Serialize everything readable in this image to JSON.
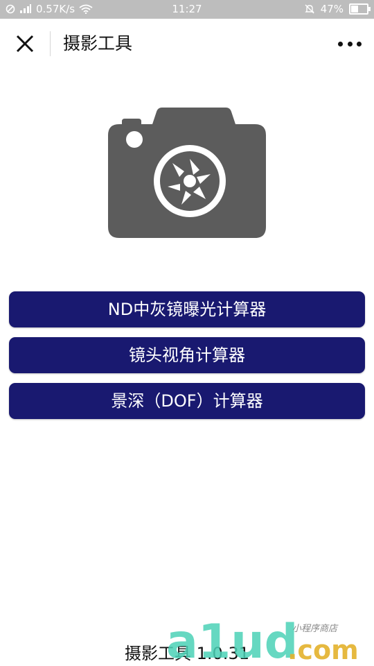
{
  "status_bar": {
    "network_speed": "0.57K/s",
    "time": "11:27",
    "battery_percent": "47%",
    "icons": [
      "no-sim-icon",
      "signal-icon",
      "wifi-icon",
      "mute-icon",
      "battery-icon"
    ]
  },
  "nav": {
    "title": "摄影工具",
    "icons": [
      "close-icon",
      "more-icon"
    ]
  },
  "hero": {
    "icon": "camera-icon",
    "color": "#5c5c5c"
  },
  "buttons": {
    "nd_calculator": "ND中灰镜曝光计算器",
    "lens_fov_calculator": "镜头视角计算器",
    "dof_calculator": "景深（DOF）计算器"
  },
  "footer": {
    "version_text": "摄影工具 1.0.31"
  },
  "watermark": {
    "brand": "a1ud",
    "domain": ".com",
    "tagline": "小程序商店"
  },
  "colors": {
    "button_bg": "#191970",
    "button_text": "#ffffff",
    "status_bar_bg": "#bdbdbd",
    "camera": "#5c5c5c"
  }
}
